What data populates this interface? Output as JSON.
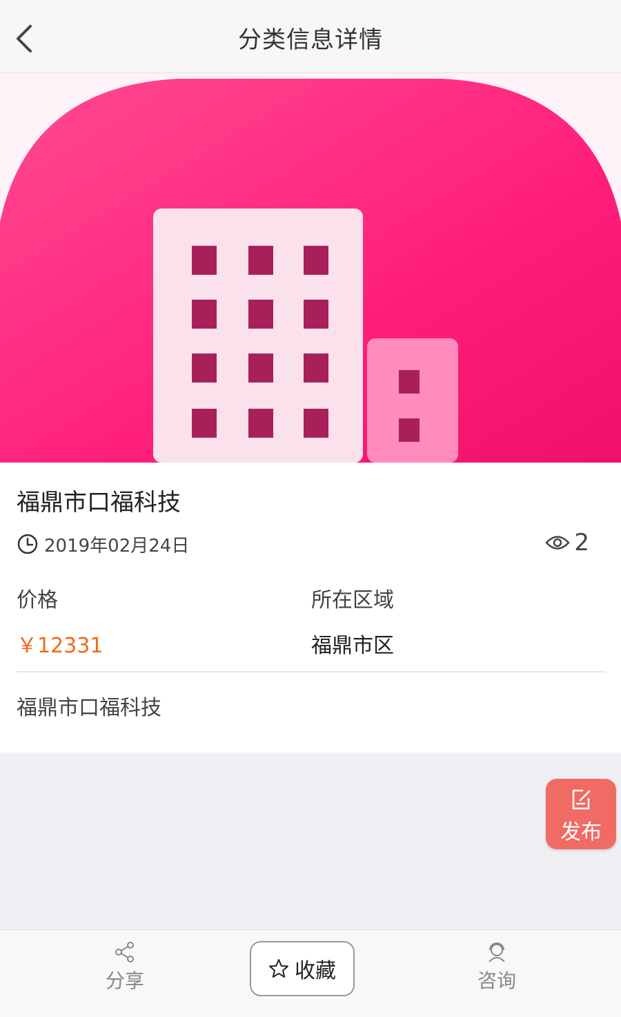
{
  "header": {
    "title": "分类信息详情",
    "back_icon": "chevron-left-icon"
  },
  "post": {
    "title": "福鼎市口福科技",
    "date": "2019年02月24日",
    "views": "2",
    "price_label": "价格",
    "price_value": "￥12331",
    "region_label": "所在区域",
    "region_value": "福鼎市区",
    "description": "福鼎市口福科技"
  },
  "fab": {
    "label": "发布",
    "icon": "edit-icon"
  },
  "bottom_bar": {
    "share_label": "分享",
    "favorite_label": "收藏",
    "consult_label": "咨询"
  },
  "colors": {
    "price": "#f06a12",
    "hero_pink": "#ff1f7a",
    "fab_bg": "#ef6b63"
  }
}
